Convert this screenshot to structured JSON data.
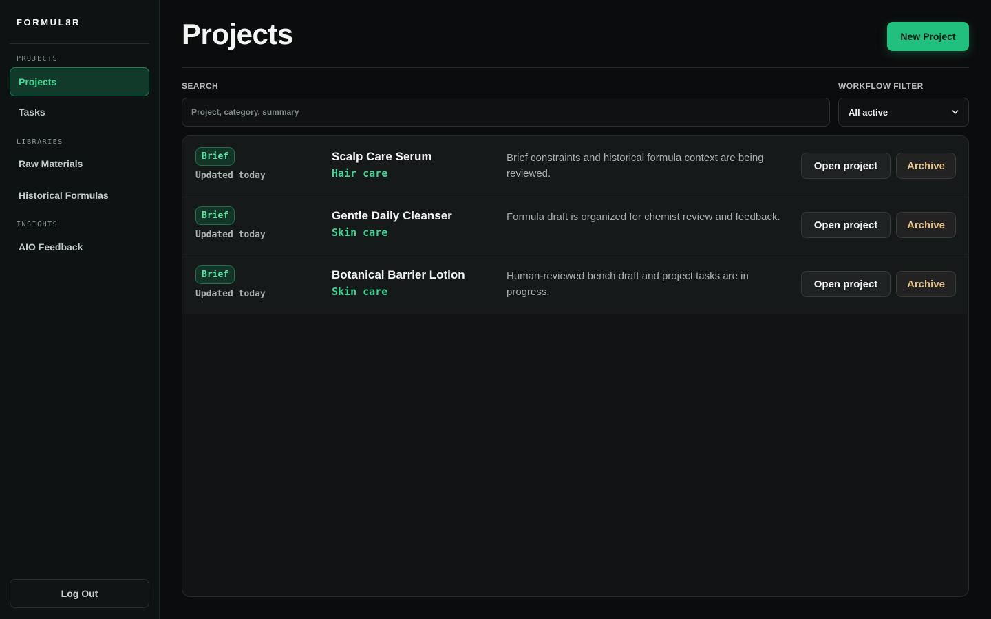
{
  "brand": "FORMUL8R",
  "sidebar": {
    "sections": [
      {
        "label": "PROJECTS",
        "items": [
          {
            "label": "Projects",
            "active": true
          },
          {
            "label": "Tasks",
            "active": false
          }
        ]
      },
      {
        "label": "LIBRARIES",
        "items": [
          {
            "label": "Raw Materials",
            "active": false
          },
          {
            "label": "Historical Formulas",
            "active": false
          }
        ]
      },
      {
        "label": "INSIGHTS",
        "items": [
          {
            "label": "AIO Feedback",
            "active": false
          }
        ]
      }
    ],
    "logout_label": "Log Out"
  },
  "header": {
    "title": "Projects",
    "new_project_label": "New Project"
  },
  "search": {
    "label": "SEARCH",
    "placeholder": "Project, category, summary",
    "value": ""
  },
  "filter": {
    "label": "WORKFLOW FILTER",
    "selected": "All active"
  },
  "projects": [
    {
      "status": "Brief",
      "updated": "Updated today",
      "name": "Scalp Care Serum",
      "category": "Hair care",
      "summary": "Brief constraints and historical formula context are being reviewed.",
      "open_label": "Open project",
      "archive_label": "Archive"
    },
    {
      "status": "Brief",
      "updated": "Updated today",
      "name": "Gentle Daily Cleanser",
      "category": "Skin care",
      "summary": "Formula draft is organized for chemist review and feedback.",
      "open_label": "Open project",
      "archive_label": "Archive"
    },
    {
      "status": "Brief",
      "updated": "Updated today",
      "name": "Botanical Barrier Lotion",
      "category": "Skin care",
      "summary": "Human-reviewed bench draft and project tasks are in progress.",
      "open_label": "Open project",
      "archive_label": "Archive"
    }
  ],
  "colors": {
    "accent": "#22c07e",
    "accent_text": "#3ed493",
    "archive_text": "#e6c38a",
    "background": "#0b0c0d"
  }
}
